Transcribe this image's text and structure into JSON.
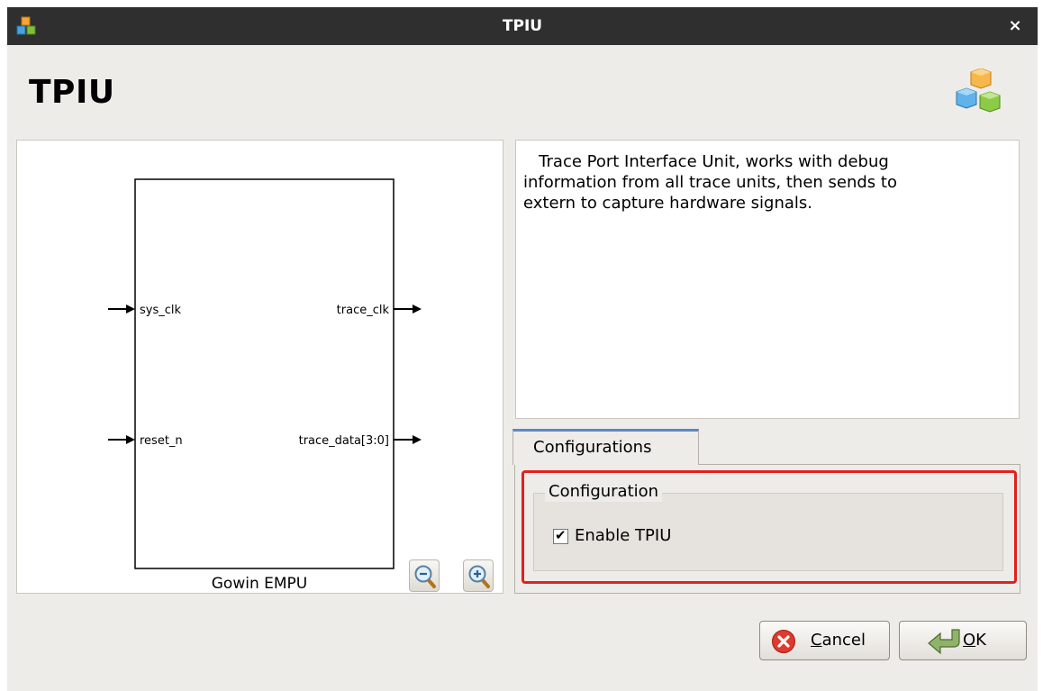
{
  "window": {
    "title": "TPIU",
    "close_label": "×",
    "app_icon": "cubes-icon"
  },
  "header": {
    "heading": "TPIU",
    "logo_icon": "cubes-logo-icon"
  },
  "diagram": {
    "block_name": "Gowin EMPU",
    "inputs": [
      "sys_clk",
      "reset_n"
    ],
    "outputs": [
      "trace_clk",
      "trace_data[3:0]"
    ],
    "zoom_out_icon": "zoom-out-icon",
    "zoom_in_icon": "zoom-in-icon"
  },
  "description": "   Trace Port Interface Unit, works with debug\ninformation from all trace units, then sends to\nextern to capture hardware signals.",
  "tabs": [
    {
      "label": "Configurations",
      "selected": true
    }
  ],
  "configuration": {
    "group_title": "Configuration",
    "enable_checkbox": {
      "label": "Enable TPIU",
      "checked": true,
      "mark": "✔"
    },
    "highlight_color": "#e3201e"
  },
  "buttons": {
    "cancel": {
      "mnemonic": "C",
      "rest": "ancel",
      "icon": "cancel-icon"
    },
    "ok": {
      "mnemonic": "O",
      "rest": "K",
      "icon": "ok-arrow-icon"
    }
  }
}
